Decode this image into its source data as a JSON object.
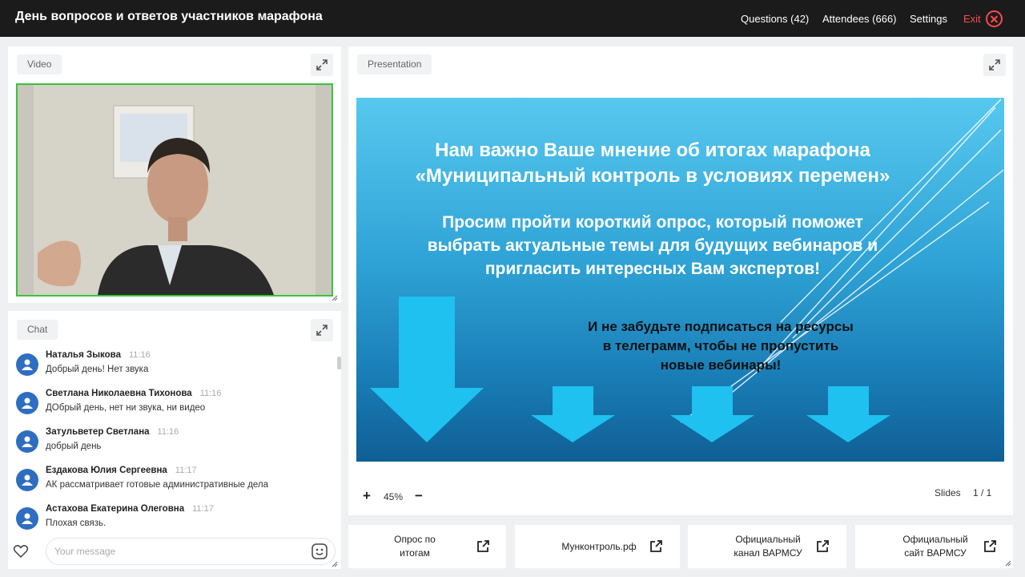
{
  "app": {
    "title": "День вопросов и ответов участников марафона"
  },
  "nav": {
    "questions": "Questions (42)",
    "attendees": "Attendees (666)",
    "settings": "Settings",
    "exit": "Exit"
  },
  "video_panel": {
    "label": "Video"
  },
  "presentation_panel": {
    "label": "Presentation"
  },
  "chat_panel": {
    "label": "Chat",
    "messages": [
      {
        "author": "Наталья Зыкова",
        "time": "11:16",
        "text": "Добрый день! Нет звука"
      },
      {
        "author": "Светлана Николаевна Тихонова",
        "time": "11:16",
        "text": "ДОбрый день, нет ни звука, ни видео"
      },
      {
        "author": "Затульветер Светлана",
        "time": "11:16",
        "text": "добрый день"
      },
      {
        "author": "Ездакова Юлия Сергеевна",
        "time": "11:17",
        "text": "АК рассматривает готовые административные дела"
      },
      {
        "author": "Астахова Екатерина Олеговна",
        "time": "11:17",
        "text": "Плохая связь."
      }
    ],
    "input_placeholder": "Your message"
  },
  "slide": {
    "title_line1": "Нам важно Ваше мнение об итогах марафона",
    "title_line2": "«Муниципальный контроль в условиях перемен»",
    "subtitle_line1": "Просим пройти короткий опрос, который поможет",
    "subtitle_line2": "выбрать актуальные темы для будущих вебинаров и",
    "subtitle_line3": "пригласить интересных Вам экспертов!",
    "note_line1": "И не забудьте подписаться на ресурсы",
    "note_line2": "в телеграмм, чтобы не пропустить",
    "note_line3": "новые вебинары!"
  },
  "controls": {
    "zoom_in": "+",
    "zoom_value": "45%",
    "zoom_out": "−",
    "slides_label": "Slides",
    "slides_count": "1 / 1"
  },
  "links": [
    {
      "line1": "Опрос по",
      "line2": "итогам"
    },
    {
      "line1": "Мунконтроль.рф",
      "line2": ""
    },
    {
      "line1": "Официальный",
      "line2": "канал ВАРМСУ"
    },
    {
      "line1": "Официальный",
      "line2": "сайт ВАРМСУ"
    }
  ],
  "colors": {
    "topbar": "#1b1b1b",
    "exit": "#ff4a4a",
    "video_border": "#3cc23c",
    "avatar": "#2e6ec1",
    "slide_top": "#57c8ef",
    "slide_bottom": "#0f5f95"
  }
}
